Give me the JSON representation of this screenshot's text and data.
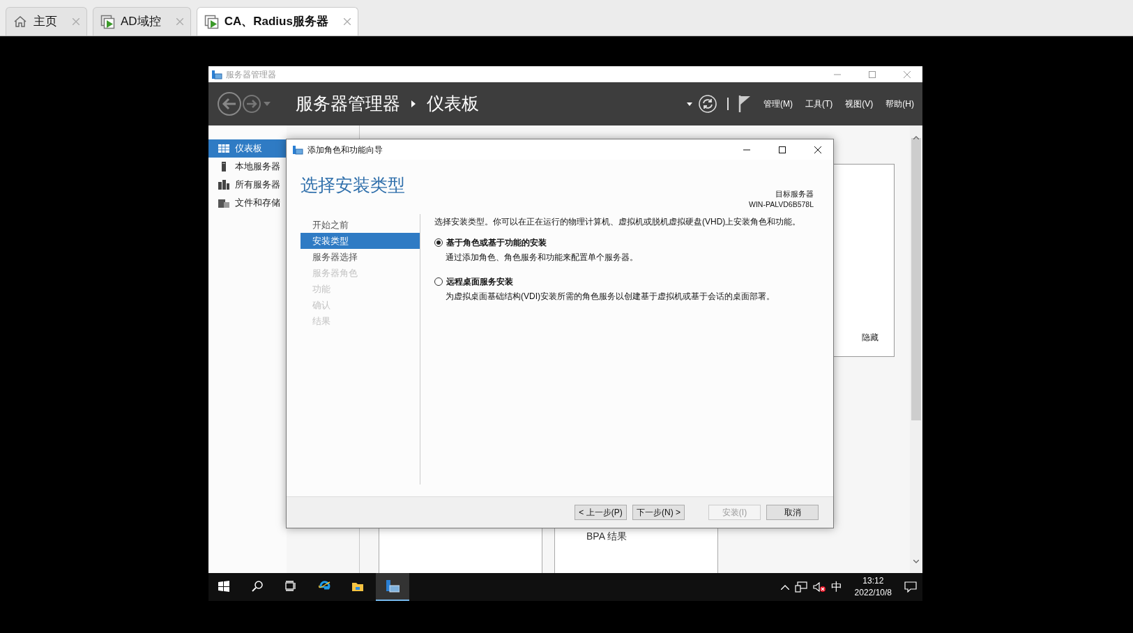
{
  "browser_tabs": [
    {
      "label": "主页",
      "kind": "home",
      "selected": false
    },
    {
      "label": "AD域控",
      "kind": "vm",
      "selected": false
    },
    {
      "label": "CA、Radius服务器",
      "kind": "vm",
      "selected": true
    }
  ],
  "server_manager": {
    "title": "服务器管理器",
    "breadcrumb": [
      "服务器管理器",
      "仪表板"
    ],
    "menus": [
      "管理(M)",
      "工具(T)",
      "视图(V)",
      "帮助(H)"
    ],
    "sidebar": [
      {
        "label": "仪表板",
        "kind": "dashboard",
        "selected": true
      },
      {
        "label": "本地服务器",
        "kind": "server",
        "selected": false
      },
      {
        "label": "所有服务器",
        "kind": "servers",
        "selected": false
      },
      {
        "label": "文件和存储",
        "kind": "storage",
        "selected": false
      }
    ],
    "panel_link": "隐藏",
    "bpa_label": "BPA 结果"
  },
  "wizard": {
    "title": "添加角色和功能向导",
    "heading": "选择安装类型",
    "target_label": "目标服务器",
    "target_name": "WIN-PALVD6B578L",
    "steps": [
      {
        "label": "开始之前",
        "selected": false,
        "disabled": false
      },
      {
        "label": "安装类型",
        "selected": true,
        "disabled": false
      },
      {
        "label": "服务器选择",
        "selected": false,
        "disabled": false
      },
      {
        "label": "服务器角色",
        "selected": false,
        "disabled": true
      },
      {
        "label": "功能",
        "selected": false,
        "disabled": true
      },
      {
        "label": "确认",
        "selected": false,
        "disabled": true
      },
      {
        "label": "结果",
        "selected": false,
        "disabled": true
      }
    ],
    "intro": "选择安装类型。你可以在正在运行的物理计算机、虚拟机或脱机虚拟硬盘(VHD)上安装角色和功能。",
    "options": [
      {
        "label": "基于角色或基于功能的安装",
        "description": "通过添加角色、角色服务和功能来配置单个服务器。",
        "selected": true
      },
      {
        "label": "远程桌面服务安装",
        "description": "为虚拟桌面基础结构(VDI)安装所需的角色服务以创建基于虚拟机或基于会话的桌面部署。",
        "selected": false
      }
    ],
    "buttons": [
      {
        "label": "< 上一步(P)",
        "disabled": false
      },
      {
        "label": "下一步(N) >",
        "disabled": false
      },
      {
        "label": "安装(I)",
        "disabled": true
      },
      {
        "label": "取消",
        "disabled": false
      }
    ]
  },
  "taskbar": {
    "apps": [
      {
        "kind": "start",
        "selected": false
      },
      {
        "kind": "search",
        "selected": false
      },
      {
        "kind": "taskview",
        "selected": false
      },
      {
        "kind": "ie",
        "selected": false
      },
      {
        "kind": "explorer",
        "selected": false
      },
      {
        "kind": "servermanager",
        "selected": true
      }
    ],
    "volume_muted": true,
    "ime": "中",
    "time": "13:12",
    "date": "2022/10/8"
  }
}
